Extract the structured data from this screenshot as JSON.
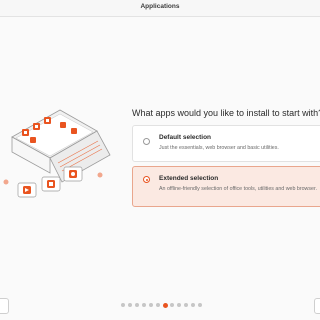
{
  "window": {
    "title": "Applications"
  },
  "page": {
    "question": "What apps would you like to install to start with?"
  },
  "options": [
    {
      "title": "Default selection",
      "description": "Just the essentials, web browser and basic utilities.",
      "selected": false
    },
    {
      "title": "Extended selection",
      "description": "An offline-friendly selection of office tools, utilities and web browser.",
      "selected": true
    }
  ],
  "pagination": {
    "total": 12,
    "current": 7
  },
  "colors": {
    "accent": "#e95420",
    "selected_bg": "#fbe9e2"
  },
  "icons": {
    "illustration": "laptop-with-apps-illustration",
    "back": "back-button",
    "next": "next-button"
  }
}
